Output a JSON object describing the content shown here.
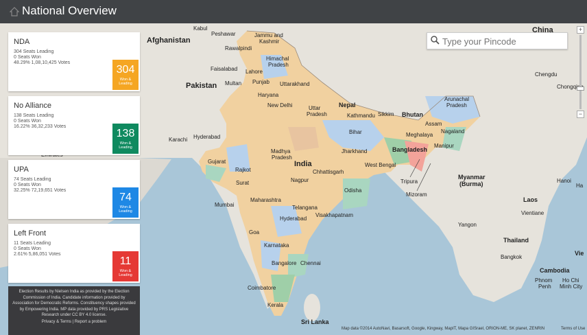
{
  "header": {
    "title": "National Overview"
  },
  "search": {
    "placeholder": "Type your Pincode"
  },
  "panels": [
    {
      "name": "NDA",
      "leading": "304 Seats Leading",
      "won": "0 Seats Won",
      "votes": "48.29% 1,08,10,425 Votes",
      "count": "304",
      "box_label_1": "Won &",
      "box_label_2": "Leading",
      "color": "#f5a623"
    },
    {
      "name": "No Alliance",
      "leading": "138 Seats Leading",
      "won": "0 Seats Won",
      "votes": "16.22% 36,32,233 Votes",
      "count": "138",
      "box_label_1": "Won &",
      "box_label_2": "Leading",
      "color": "#0f8a5f"
    },
    {
      "name": "UPA",
      "leading": "74 Seats Leading",
      "won": "0 Seats Won",
      "votes": "32.25% 72,19,651 Votes",
      "count": "74",
      "box_label_1": "Won &",
      "box_label_2": "Leading",
      "color": "#1e88e5"
    },
    {
      "name": "Left Front",
      "leading": "11 Seats Leading",
      "won": "0 Seats Won",
      "votes": "2.61% 5,86,051 Votes",
      "count": "11",
      "box_label_1": "Won &",
      "box_label_2": "Leading",
      "color": "#e53935"
    }
  ],
  "credits": {
    "text": "Election Results by Nielsen India as provided by the Election Commission of India. Candidate information provided by Association for Democratic Reforms. Constituency shapes provided by Empowering India. MP data provided by PRS Legislative Research under CC BY 4.0 license.",
    "privacy": "Privacy & Terms",
    "sep": "|",
    "report": "Report a problem"
  },
  "map": {
    "attribution": "Map data ©2014 AutoNavi, Basarsoft, Google, Kingway, MapIT, Mapa GISrael, ORION-ME, SK planet, ZENRIN",
    "terms": "Terms of Use",
    "zoom_in": "+",
    "zoom_out": "−",
    "labels": {
      "afghanistan": "Afghanistan",
      "pakistan": "Pakistan",
      "china": "China",
      "nepal": "Nepal",
      "bhutan": "Bhutan",
      "bangladesh": "Bangladesh",
      "india": "India",
      "myanmar": "Myanmar",
      "burma": "(Burma)",
      "laos": "Laos",
      "thailand": "Thailand",
      "cambodia": "Cambodia",
      "sri_lanka": "Sri Lanka",
      "kabul": "Kabul",
      "peshawar": "Peshawar",
      "rawalpindi": "Rawalpindi",
      "faisalabad": "Faisalabad",
      "lahore": "Lahore",
      "multan": "Multan",
      "karachi": "Karachi",
      "hyderabad_pk": "Hyderabad",
      "jammu": "Jammu and",
      "kashmir": "Kashmir",
      "himachal": "Himachal",
      "pradesh_hp": "Pradesh",
      "punjab": "Punjab",
      "uttarakhand": "Uttarakhand",
      "haryana": "Haryana",
      "new_delhi": "New Delhi",
      "uttar": "Uttar",
      "pradesh_up": "Pradesh",
      "kathmandu": "Kathmandu",
      "sikkim": "Sikkim",
      "arunachal": "Arunachal",
      "pradesh_ap": "Pradesh",
      "assam": "Assam",
      "nagaland": "Nagaland",
      "meghalaya": "Meghalaya",
      "manipur": "Manipur",
      "tripura": "Tripura",
      "mizoram": "Mizoram",
      "west_bengal": "West Bengal",
      "jharkhand": "Jharkhand",
      "bihar": "Bihar",
      "madhya": "Madhya",
      "pradesh_mp": "Pradesh",
      "gujarat": "Gujarat",
      "rajkot": "Rajkot",
      "surat": "Surat",
      "mumbai": "Mumbai",
      "maharashtra": "Maharashtra",
      "nagpur": "Nagpur",
      "chhattisgarh": "Chhattisgarh",
      "odisha": "Odisha",
      "telangana": "Telangana",
      "hyderabad_in": "Hyderabad",
      "visakhapatnam": "Visakhapatnam",
      "goa": "Goa",
      "karnataka": "Karnataka",
      "bangalore": "Bangalore",
      "chennai": "Chennai",
      "coimbatore": "Coimbatore",
      "kerala": "Kerala",
      "chengdu": "Chengdu",
      "chongqing": "Chongqing",
      "hanoi": "Hanoi",
      "vientiane": "Vientiane",
      "yangon": "Yangon",
      "bangkok": "Bangkok",
      "phnom": "Phnom",
      "penh": "Penh",
      "ho_chi": "Ho Chi",
      "minh_city": "Minh City",
      "vie": "Vie",
      "ha": "Ha",
      "emirates": "Emirates"
    }
  }
}
